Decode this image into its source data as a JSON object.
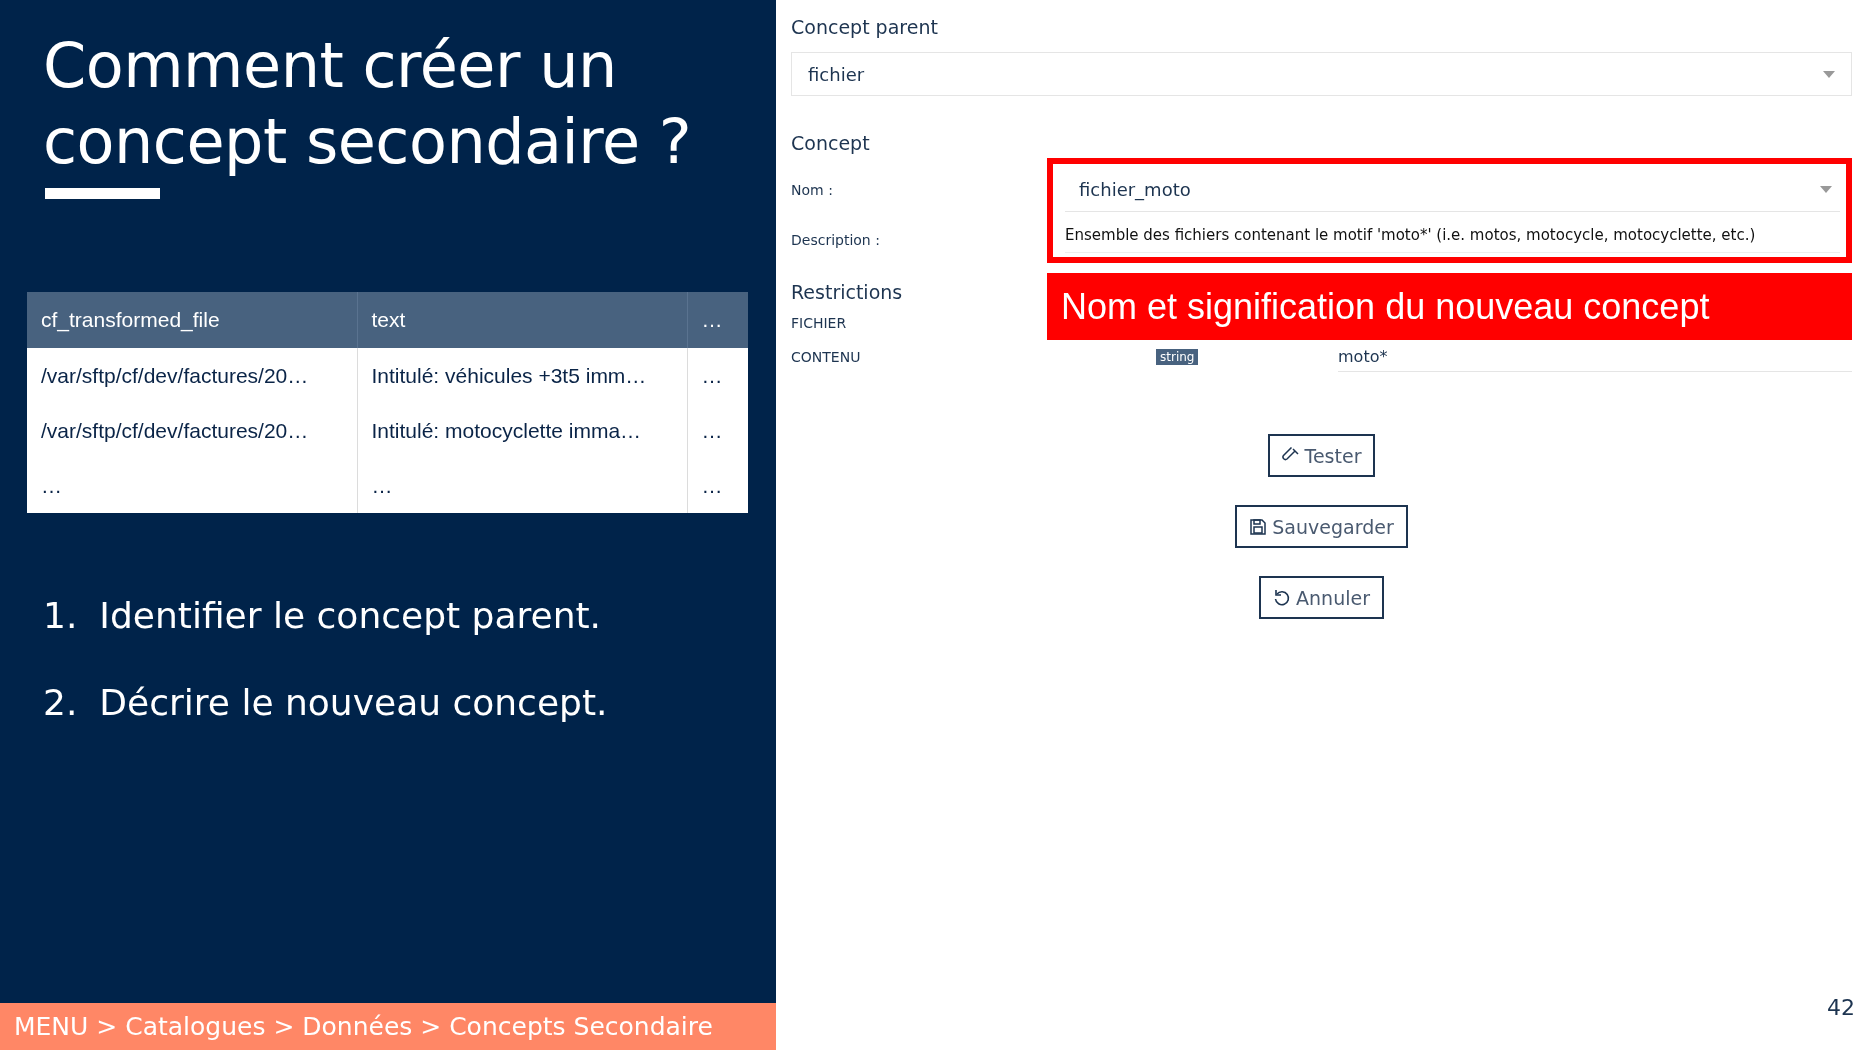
{
  "slide": {
    "title": "Comment créer un concept secondaire ?",
    "table": {
      "columns": [
        "cf_transformed_file",
        "text",
        "…"
      ],
      "rows": [
        [
          "/var/sftp/cf/dev/factures/20…",
          "Intitulé:  véhicules +3t5 imm…",
          "…"
        ],
        [
          "/var/sftp/cf/dev/factures/20…",
          "Intitulé:  motocyclette imma…",
          "…"
        ],
        [
          "…",
          "…",
          "…"
        ]
      ]
    },
    "steps": [
      {
        "number": "1.",
        "text": "Identifier le concept parent."
      },
      {
        "number": "2.",
        "text": "Décrire le nouveau concept."
      }
    ],
    "breadcrumb": "MENU > Catalogues > Données > Concepts Secondaire",
    "page_number": "42"
  },
  "form": {
    "parent_heading": "Concept parent",
    "parent_select": {
      "value": "fichier"
    },
    "concept_heading": "Concept",
    "name_label": "Nom :",
    "name_select": {
      "value": "fichier_moto"
    },
    "description_label": "Description :",
    "description": "Ensemble des fichiers contenant le motif 'moto*'  (i.e. motos, motocycle, motocyclette, etc.)",
    "callout": "Nom et signification du nouveau concept",
    "restrictions_heading": "Restrictions",
    "restrictions": [
      {
        "label": "FICHIER"
      },
      {
        "label": "CONTENU",
        "type_badge": "string",
        "value": "moto*"
      }
    ],
    "buttons": [
      {
        "kind": "test",
        "label": "Tester"
      },
      {
        "kind": "save",
        "label": "Sauvegarder"
      },
      {
        "kind": "cancel",
        "label": "Annuler"
      }
    ]
  }
}
